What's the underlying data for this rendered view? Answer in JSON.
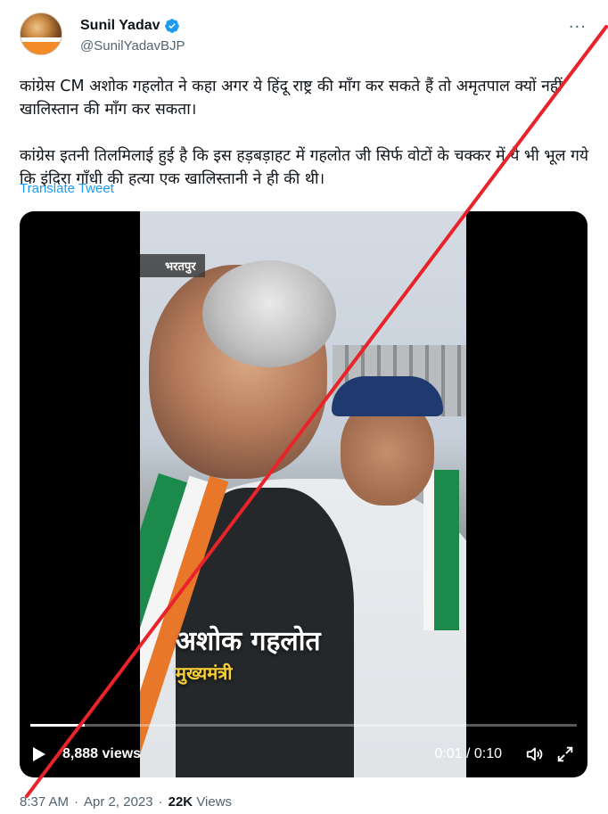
{
  "author": {
    "display_name": "Sunil Yadav",
    "handle": "@SunilYadavBJP",
    "verified_icon": "verified-badge-icon",
    "badge_color": "#1d9bf0"
  },
  "more_label": "···",
  "tweet": {
    "text_line1": "कांग्रेस CM अशोक गहलोत ने कहा अगर ये हिंदू राष्ट्र की माँग कर सकते हैं तो अमृतपाल क्यों नहीं खालिस्तान की माँग कर सकता।",
    "text_line2": "कांग्रेस इतनी तिलमिलाई हुई है कि इस हड़बड़ाहट में गहलोत जी सिर्फ वोटों के चक्कर में ये भी भूल गये कि इंदिरा गाँधी की हत्या एक खालिस्तानी ने ही की थी।",
    "translate_label": "Translate Tweet"
  },
  "video": {
    "location_tag": "भरतपुर",
    "caption_name": "अशोक गहलोत",
    "caption_role": "मुख्यमंत्री",
    "views": "8,888 views",
    "time": "0:01 / 0:10",
    "progress": 0.1
  },
  "footer": {
    "time": "8:37 AM",
    "separator": "·",
    "date": "Apr 2, 2023",
    "separator2": "·",
    "views_count": "22K",
    "views_label": "Views"
  },
  "overlay": {
    "cross_color": "#e8232a"
  }
}
